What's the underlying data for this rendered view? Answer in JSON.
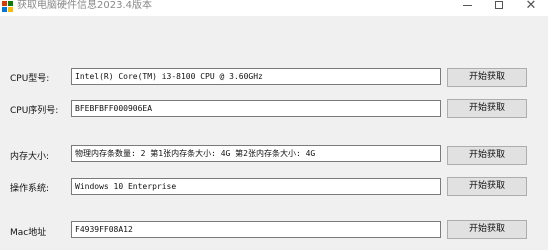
{
  "window": {
    "title": "获取电脑硬件信息2023.4版本",
    "minimize_glyph": "—",
    "maximize_glyph": "☐",
    "close_glyph": "✕"
  },
  "rows": [
    {
      "label": "CPU型号:",
      "value": "Intel(R) Core(TM) i3-8100 CPU @ 3.60GHz",
      "button": "开始获取"
    },
    {
      "label": "CPU序列号:",
      "value": "BFEBFBFF000906EA",
      "button": "开始获取"
    },
    {
      "label": "内存大小:",
      "value": "物理内存条数量: 2  第1张内存条大小: 4G   第2张内存条大小: 4G",
      "button": "开始获取"
    },
    {
      "label": "操作系统:",
      "value": "Windows 10 Enterprise",
      "button": "开始获取"
    },
    {
      "label": "Mac地址",
      "value": "F4939FF08A12",
      "button": "开始获取"
    }
  ],
  "colors": {
    "window_bg": "#f0f0f0",
    "field_bg": "#ffffff",
    "button_bg": "#e1e1e1",
    "title_text": "#8a8a8a"
  },
  "icons": {
    "app": "app-icon",
    "minimize": "minimize-icon",
    "maximize": "maximize-icon",
    "close": "close-icon"
  }
}
